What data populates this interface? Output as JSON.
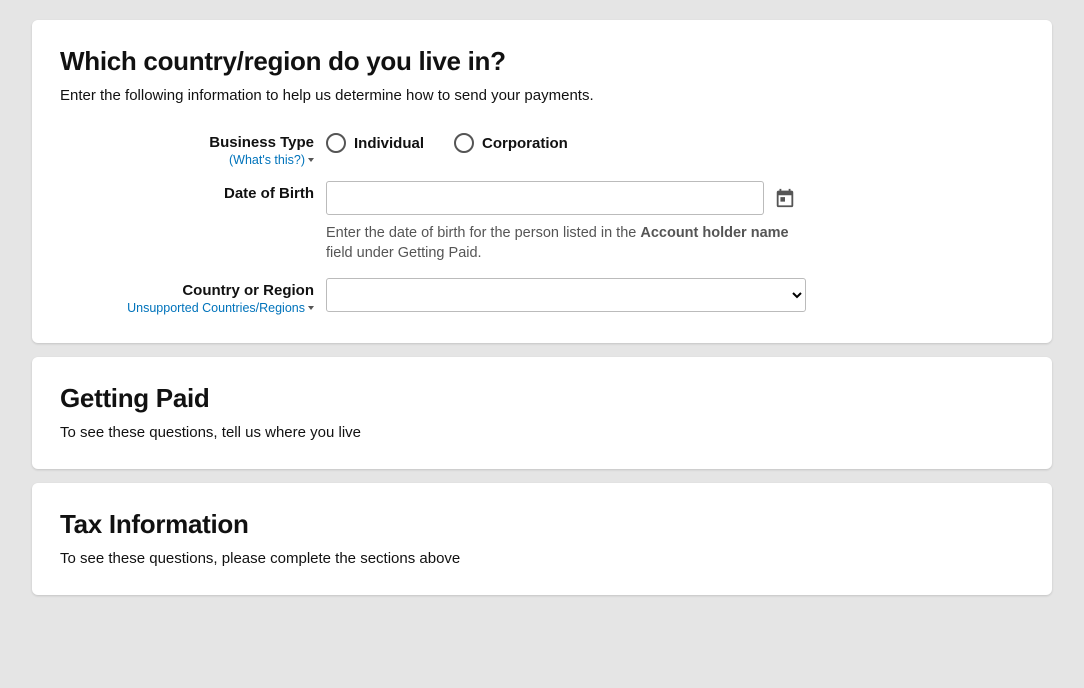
{
  "section1": {
    "title": "Which country/region do you live in?",
    "subtitle": "Enter the following information to help us determine how to send your payments.",
    "business_type": {
      "label": "Business Type",
      "help_link": "(What's this?)",
      "option_individual": "Individual",
      "option_corporation": "Corporation"
    },
    "dob": {
      "label": "Date of Birth",
      "help_pre": "Enter the date of birth for the person listed in the ",
      "help_strong": "Account holder name",
      "help_post": " field under Getting Paid."
    },
    "country": {
      "label": "Country or Region",
      "help_link": "Unsupported Countries/Regions"
    }
  },
  "section2": {
    "title": "Getting Paid",
    "note": "To see these questions, tell us where you live"
  },
  "section3": {
    "title": "Tax Information",
    "note": "To see these questions, please complete the sections above"
  }
}
